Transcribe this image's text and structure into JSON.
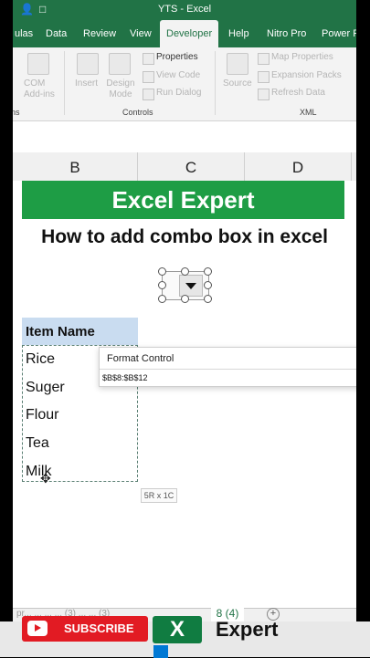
{
  "window": {
    "title": "YTS - Excel"
  },
  "ribbon_tabs": [
    "ulas",
    "Data",
    "Review",
    "View",
    "Developer",
    "Help",
    "Nitro Pro",
    "Power P"
  ],
  "active_tab": "Developer",
  "ribbon": {
    "controls": {
      "insert": "Insert",
      "design_mode": "Design Mode",
      "properties": "Properties",
      "view_code": "View Code",
      "run_dialog": "Run Dialog",
      "group_label": "Controls"
    },
    "addins": {
      "com": "COM Add-ins",
      "group_label": "ns"
    },
    "xml": {
      "source": "Source",
      "map_properties": "Map Properties",
      "expansion_packs": "Expansion Packs",
      "refresh_data": "Refresh Data",
      "group_label": "XML"
    }
  },
  "columns": [
    "B",
    "C",
    "D"
  ],
  "sheet": {
    "banner": "Excel Expert",
    "subtitle": "How to add combo box in excel",
    "header_cell": "Item Name",
    "items": [
      "Rice",
      "Suger",
      "Flour",
      "Tea",
      "Milk"
    ],
    "selection_size": "5R x 1C"
  },
  "format_control": {
    "title": "Format Control",
    "input_value": "$B$8:$B$12"
  },
  "sheet_tabs": {
    "faded": "pr... ... ... ... (3) ... ... (3)",
    "active": "8 (4)"
  },
  "watermark": {
    "subscribe": "SUBSCRIBE",
    "logo_letters": "X",
    "expert": "Expert"
  },
  "colors": {
    "excel_green": "#217346",
    "banner_green": "#1e9d45",
    "header_blue": "#c9dcf0",
    "subscribe_red": "#e21b23"
  }
}
